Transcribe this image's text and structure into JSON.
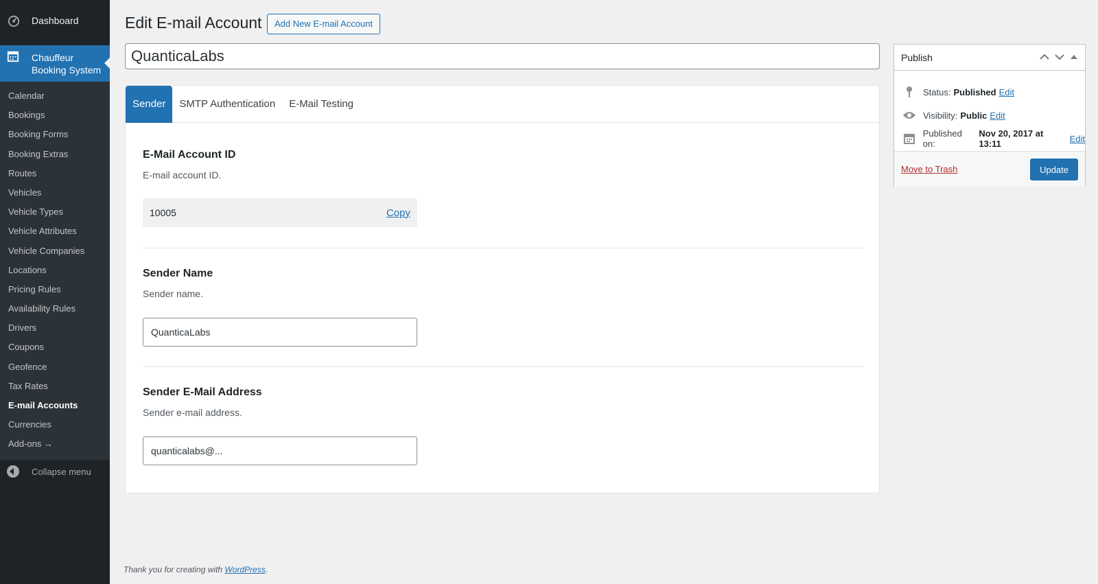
{
  "sidebar": {
    "dashboard": "Dashboard",
    "current_menu": "Chauffeur Booking System",
    "items": [
      "Calendar",
      "Bookings",
      "Booking Forms",
      "Booking Extras",
      "Routes",
      "Vehicles",
      "Vehicle Types",
      "Vehicle Attributes",
      "Vehicle Companies",
      "Locations",
      "Pricing Rules",
      "Availability Rules",
      "Drivers",
      "Coupons",
      "Geofence",
      "Tax Rates",
      "E-mail Accounts",
      "Currencies",
      "Add-ons →"
    ],
    "active_item": "E-mail Accounts",
    "collapse": "Collapse menu"
  },
  "header": {
    "title": "Edit E-mail Account",
    "add_new": "Add New E-mail Account"
  },
  "post_title": "QuanticaLabs",
  "tabs": [
    "Sender",
    "SMTP Authentication",
    "E-Mail Testing"
  ],
  "active_tab": "Sender",
  "fields": {
    "account_id": {
      "label": "E-Mail Account ID",
      "desc": "E-mail account ID.",
      "value": "10005",
      "copy": "Copy"
    },
    "sender_name": {
      "label": "Sender Name",
      "desc": "Sender name.",
      "value": "QuanticaLabs"
    },
    "sender_email": {
      "label": "Sender E-Mail Address",
      "desc": "Sender e-mail address.",
      "value": "quanticalabs@..."
    }
  },
  "publish": {
    "title": "Publish",
    "status_label": "Status:",
    "status_value": "Published",
    "visibility_label": "Visibility:",
    "visibility_value": "Public",
    "published_label": "Published on:",
    "published_value": "Nov 20, 2017 at 13:11",
    "edit": "Edit",
    "trash": "Move to Trash",
    "update": "Update"
  },
  "footer": {
    "text": "Thank you for creating with ",
    "link": "WordPress",
    "period": "."
  },
  "colors": {
    "accent": "#2271b1",
    "sidebar": "#1d2327",
    "trash": "#b32d2e"
  }
}
